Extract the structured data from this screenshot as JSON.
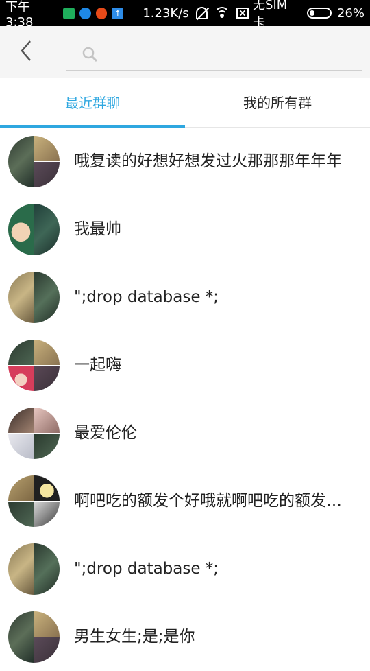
{
  "status_bar": {
    "time": "下午3:38",
    "speed": "1.23K/s",
    "sim": "无SIM卡",
    "battery": "26%",
    "battery_level": 0.26
  },
  "search": {
    "placeholder": ""
  },
  "tabs": [
    {
      "label": "最近群聊",
      "active": true
    },
    {
      "label": "我的所有群",
      "active": false
    }
  ],
  "colors": {
    "accent": "#2ea7e0",
    "text": "#222222",
    "header_bg": "#f5f5f5"
  },
  "groups": [
    {
      "name": "哦复读的好想好想发过火那那那年年年"
    },
    {
      "name": "我最帅"
    },
    {
      "name": "\";drop database *;"
    },
    {
      "name": "一起嗨"
    },
    {
      "name": "最爱伦伦"
    },
    {
      "name": "啊吧吃的额发个好哦就啊吧吃的额发个好"
    },
    {
      "name": "\";drop database *;"
    },
    {
      "name": "男生女生;是;是你"
    }
  ]
}
